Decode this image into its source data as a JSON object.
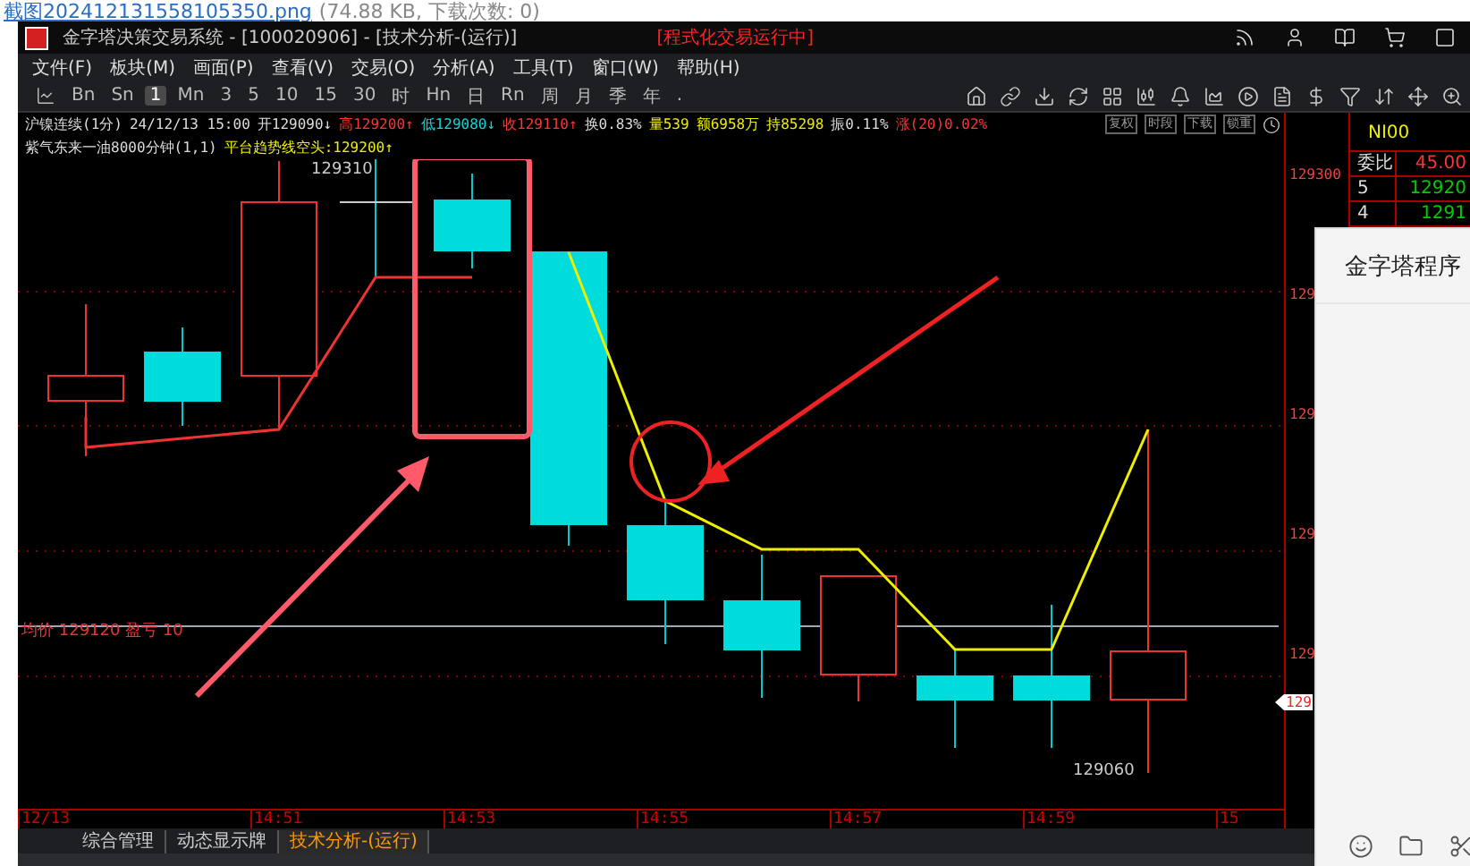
{
  "page_header": {
    "file_name": "截图20241213155810535​0.png",
    "file_info": "(74.88 KB, 下载次数: 0)"
  },
  "window": {
    "title": "金字塔决策交易系统 - [100020906] - [技术分析-(运行)]",
    "status": "[程式化交易运行中]"
  },
  "menu": [
    "文件(F)",
    "板块(M)",
    "画面(P)",
    "查看(V)",
    "交易(O)",
    "分析(A)",
    "工具(T)",
    "窗口(W)",
    "帮助(H)"
  ],
  "periods": [
    {
      "label": "Bn",
      "selected": false
    },
    {
      "label": "Sn",
      "selected": false
    },
    {
      "label": "1",
      "selected": true
    },
    {
      "label": "Mn",
      "selected": false
    },
    {
      "label": "3",
      "selected": false
    },
    {
      "label": "5",
      "selected": false
    },
    {
      "label": "10",
      "selected": false
    },
    {
      "label": "15",
      "selected": false
    },
    {
      "label": "30",
      "selected": false
    },
    {
      "label": "时",
      "selected": false
    },
    {
      "label": "Hn",
      "selected": false
    },
    {
      "label": "日",
      "selected": false
    },
    {
      "label": "Rn",
      "selected": false
    },
    {
      "label": "周",
      "selected": false
    },
    {
      "label": "月",
      "selected": false
    },
    {
      "label": "季",
      "selected": false
    },
    {
      "label": "年",
      "selected": false
    },
    {
      "label": ".",
      "selected": false
    }
  ],
  "quote_line": [
    {
      "text": "沪镍连续(1分)",
      "kind": "plain"
    },
    {
      "text": "24/12/13 15:00",
      "kind": "plain"
    },
    {
      "text": "开129090↓",
      "kind": "plain"
    },
    {
      "text": "高129200↑",
      "kind": "up"
    },
    {
      "text": "低129080↓",
      "kind": "down"
    },
    {
      "text": "收129110↑",
      "kind": "up"
    },
    {
      "text": "换0.83%",
      "kind": "plain"
    },
    {
      "text": "量539",
      "kind": "volume"
    },
    {
      "text": "额6958万",
      "kind": "volume"
    },
    {
      "text": "持85298",
      "kind": "volume"
    },
    {
      "text": "振0.11%",
      "kind": "plain"
    },
    {
      "text": "涨(20)0.02%",
      "kind": "up"
    }
  ],
  "chart_buttons": [
    "复权",
    "时段",
    "下载",
    "锁重"
  ],
  "indicator_line": [
    {
      "text": "紫气东来一油8000分钟(1,1)",
      "kind": "plain"
    },
    {
      "text": "平台趋势线空头:129200↑",
      "kind": "volume"
    }
  ],
  "chart": {
    "high_label": "129310",
    "low_label": "129060",
    "position_label": "均价 129120 盈亏 10",
    "time_labels": [
      "12/13",
      "14:51",
      "14:53",
      "14:55",
      "14:57",
      "14:59",
      "15"
    ],
    "price_labels": [
      "129300",
      "129",
      "129",
      "129",
      "129"
    ],
    "last_price": "129"
  },
  "order_book": {
    "symbol": "NI00",
    "ratio_label": "委比",
    "ratio_value": "45.00",
    "rows": [
      {
        "level": "5",
        "price": "12920"
      },
      {
        "level": "4",
        "price": "1291"
      }
    ]
  },
  "dialog": {
    "title": "金字塔程序"
  },
  "tabs": [
    {
      "label": "综合管理",
      "selected": false
    },
    {
      "label": "动态显示牌",
      "selected": false
    },
    {
      "label": "技术分析-(运行)",
      "selected": true
    }
  ]
}
